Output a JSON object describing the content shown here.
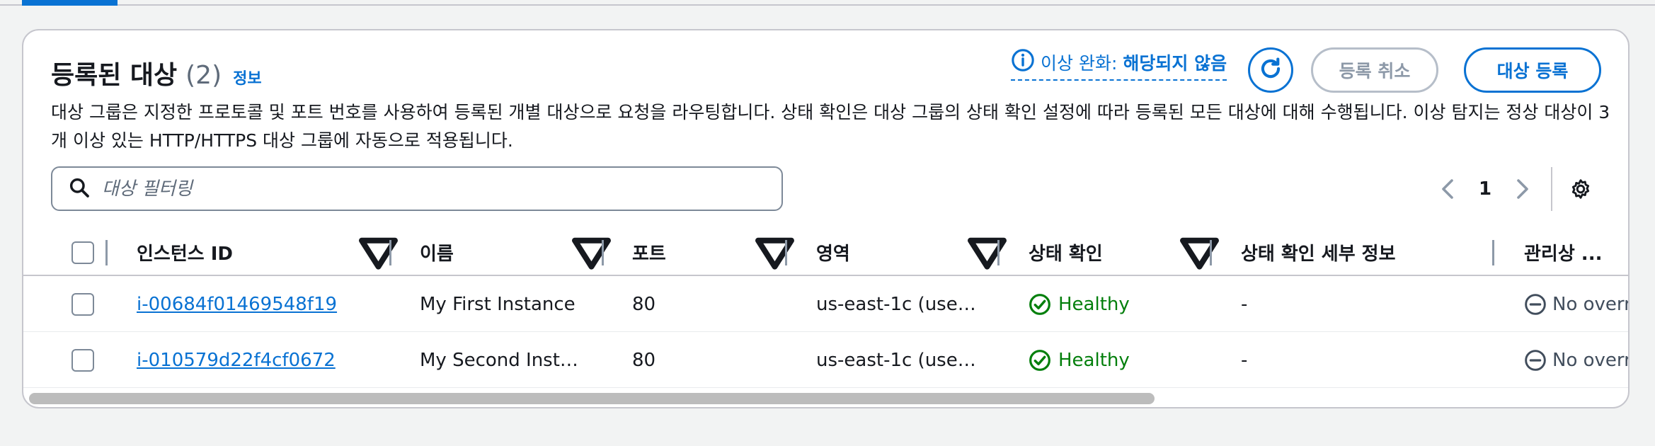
{
  "panel": {
    "title": "등록된 대상",
    "count": "(2)",
    "info_link": "정보",
    "anomaly_label": "이상 완화:",
    "anomaly_value": "해당되지 않음",
    "deregister_label": "등록 취소",
    "register_label": "대상 등록",
    "description": "대상 그룹은 지정한 프로토콜 및 포트 번호를 사용하여 등록된 개별 대상으로 요청을 라우팅합니다. 상태 확인은 대상 그룹의 상태 확인 설정에 따라 등록된 모든 대상에 대해 수행됩니다. 이상 탐지는 정상 대상이 3개 이상 있는 HTTP/HTTPS 대상 그룹에 자동으로 적용됩니다."
  },
  "filter": {
    "placeholder": "대상 필터링"
  },
  "pagination": {
    "current_page": "1"
  },
  "table": {
    "columns": [
      "인스턴스 ID",
      "이름",
      "포트",
      "영역",
      "상태 확인",
      "상태 확인 세부 정보",
      "관리상 ..."
    ],
    "rows": [
      {
        "instance_id": "i-00684f01469548f19",
        "name": "My First Instance",
        "port": "80",
        "zone": "us-east-1c (use…",
        "health": "Healthy",
        "health_detail": "-",
        "admin": "No overr"
      },
      {
        "instance_id": "i-010579d22f4cf0672",
        "name": "My Second Inst…",
        "port": "80",
        "zone": "us-east-1c (use…",
        "health": "Healthy",
        "health_detail": "-",
        "admin": "No overr"
      }
    ]
  },
  "colors": {
    "accent": "#0972d3",
    "healthy": "#037f0c",
    "border": "#c6c6cd"
  }
}
